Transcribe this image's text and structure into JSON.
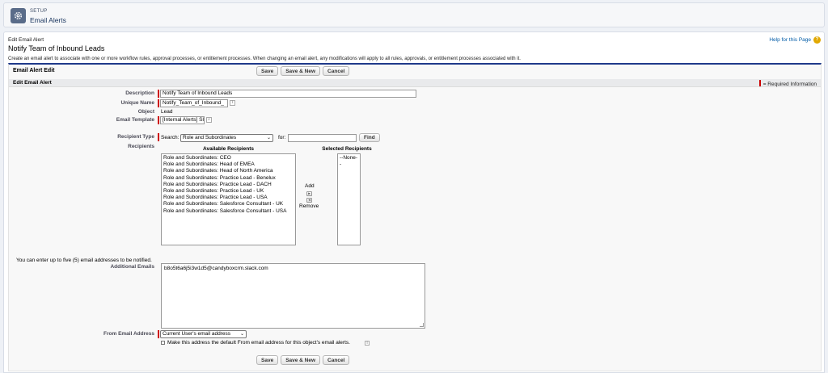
{
  "setup": {
    "small_label": "SETUP",
    "title": "Email Alerts"
  },
  "page": {
    "crumb": "Edit Email Alert",
    "title": "Notify Team of Inbound Leads",
    "help_link": "Help for this Page",
    "help_icon": "?",
    "description": "Create an email alert to associate with one or more workflow rules, approval processes, or entitlement processes. When changing an email alert, any modifications will apply to all rules, approvals, or entitlement processes associated with it."
  },
  "block": {
    "title": "Email Alert Edit",
    "buttons": {
      "save": "Save",
      "save_new": "Save & New",
      "cancel": "Cancel"
    }
  },
  "section": {
    "title": "Edit Email Alert",
    "required_note": "= Required Information"
  },
  "form": {
    "description_label": "Description",
    "description_value": "Notify Team of Inbound Leads",
    "unique_name_label": "Unique Name",
    "unique_name_value": "Notify_Team_of_Inbound_",
    "object_label": "Object",
    "object_value": "Lead",
    "template_label": "Email Template",
    "template_value": "[Internal Alerts] Slack - Ne",
    "recipient_type_label": "Recipient Type",
    "search_label": "Search:",
    "search_select": "Role and Subordinates",
    "for_label": "for:",
    "for_value": "",
    "find_button": "Find",
    "recipients_label": "Recipients",
    "available_header": "Available Recipients",
    "selected_header": "Selected Recipients",
    "available": [
      "Role and Subordinates: CEO",
      "Role and Subordinates: Head of EMEA",
      "Role and Subordinates: Head of North America",
      "Role and Subordinates: Practice Lead - Benelux",
      "Role and Subordinates: Practice Lead - DACH",
      "Role and Subordinates: Practice Lead - UK",
      "Role and Subordinates: Practice Lead - USA",
      "Role and Subordinates: Salesforce Consultant - UK",
      "Role and Subordinates: Salesforce Consultant - USA"
    ],
    "selected": [
      "--None--"
    ],
    "add_label": "Add",
    "remove_label": "Remove",
    "add_arrow": "▸",
    "remove_arrow": "◂",
    "email_note": "You can enter up to five (5) email addresses to be notified.",
    "additional_emails_label": "Additional Emails",
    "additional_emails_value": "b8o5t6a6j5i3w1d5@candyboxcrm.slack.com",
    "from_label": "From Email Address",
    "from_value": "Current User's email address",
    "default_checkbox_label": "Make this address the default From email address for this object's email alerts."
  }
}
